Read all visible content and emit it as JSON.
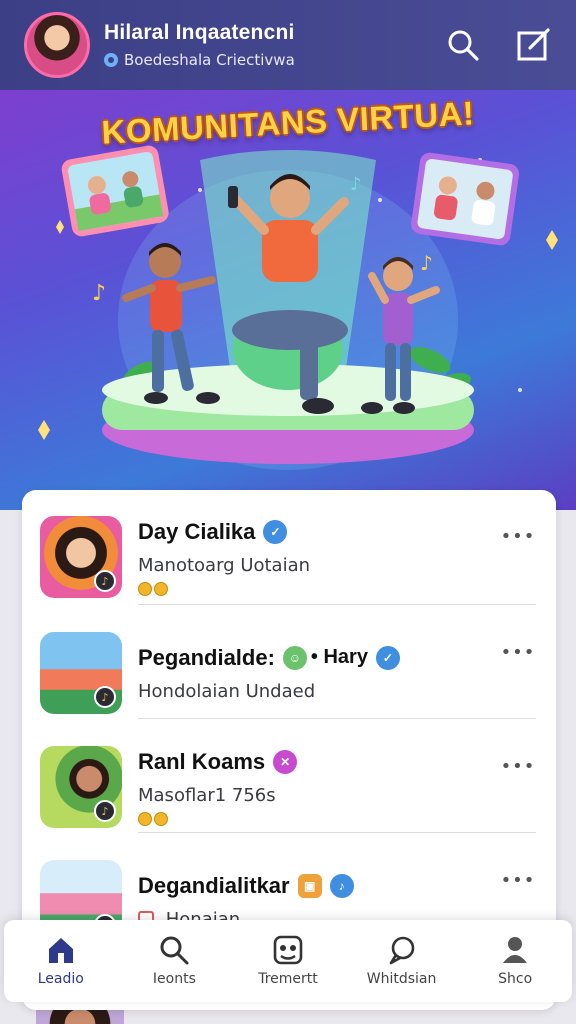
{
  "header": {
    "title": "Hilaral Inqaatencni",
    "subtitle": "Boedeshala Criectivwa",
    "search_icon": "search-icon",
    "compose_icon": "compose-icon"
  },
  "hero": {
    "banner_text": "KOMUNITANS VIRTUA!"
  },
  "list": {
    "items": [
      {
        "title": "Day Cialika",
        "subtitle": "Manotoarg Uotaian",
        "more": "•••",
        "tag_color": "#3f8ee0"
      },
      {
        "title": "Pegandialde:",
        "title_extra": "• Hary",
        "subtitle": "Hondolaian Undaed",
        "more": "•••",
        "tag_color": "#6cc26a",
        "tag2_color": "#3f8ee0"
      },
      {
        "title": "Ranl Koams",
        "subtitle": "Masoflar1 756s",
        "more": "•••",
        "tag_color": "#c84bcf"
      },
      {
        "title": "Degandialitkar",
        "subtitle": "Honaian",
        "more": "•••",
        "tag_color": "#f0a23a",
        "tag2_color": "#3f8ee0"
      }
    ]
  },
  "nav": {
    "items": [
      {
        "label": "Leadio",
        "icon": "home-icon"
      },
      {
        "label": "Ieonts",
        "icon": "search-icon"
      },
      {
        "label": "Tremertt",
        "icon": "community-icon"
      },
      {
        "label": "Whitdsian",
        "icon": "chat-icon"
      },
      {
        "label": "Shco",
        "icon": "profile-icon"
      }
    ]
  },
  "colors": {
    "header_bg": "#3c3f86",
    "accent": "#2d3a8c",
    "banner": "#ffd24a"
  }
}
